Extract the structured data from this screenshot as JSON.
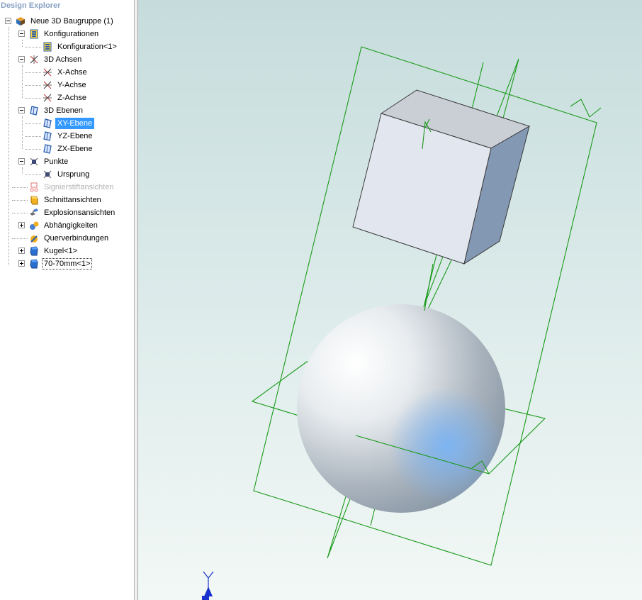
{
  "explorer": {
    "title": "Design Explorer",
    "nodes": [
      {
        "label": "Neue 3D Baugruppe (1)",
        "icon": "assembly-cube-icon"
      },
      {
        "label": "Konfigurationen",
        "icon": "configurations-icon"
      },
      {
        "label": "Konfiguration<1>",
        "icon": "configuration-icon"
      },
      {
        "label": "3D Achsen",
        "icon": "axes-icon"
      },
      {
        "label": "X-Achse",
        "icon": "axis-icon"
      },
      {
        "label": "Y-Achse",
        "icon": "axis-icon"
      },
      {
        "label": "Z-Achse",
        "icon": "axis-icon"
      },
      {
        "label": "3D Ebenen",
        "icon": "planes-icon"
      },
      {
        "label": "XY-Ebene",
        "icon": "plane-icon"
      },
      {
        "label": "YZ-Ebene",
        "icon": "plane-icon"
      },
      {
        "label": "ZX-Ebene",
        "icon": "plane-icon"
      },
      {
        "label": "Punkte",
        "icon": "points-icon"
      },
      {
        "label": "Ursprung",
        "icon": "origin-point-icon"
      },
      {
        "label": "Signierstiftansichten",
        "icon": "markup-pen-icon"
      },
      {
        "label": "Schnittansichten",
        "icon": "section-view-icon"
      },
      {
        "label": "Explosionsansichten",
        "icon": "exploded-view-icon"
      },
      {
        "label": "Abhängigkeiten",
        "icon": "constraints-icon"
      },
      {
        "label": "Querverbindungen",
        "icon": "cross-links-icon"
      },
      {
        "label": "Kugel<1>",
        "icon": "part-icon"
      },
      {
        "label": "70-70mm<1>",
        "icon": "part-icon"
      }
    ]
  },
  "viewport": {
    "axis_label": "Y",
    "colors": {
      "plane_lines": "#1a9a1a",
      "selection": "#3399ff",
      "axis_triad": "#1a33cc"
    }
  }
}
